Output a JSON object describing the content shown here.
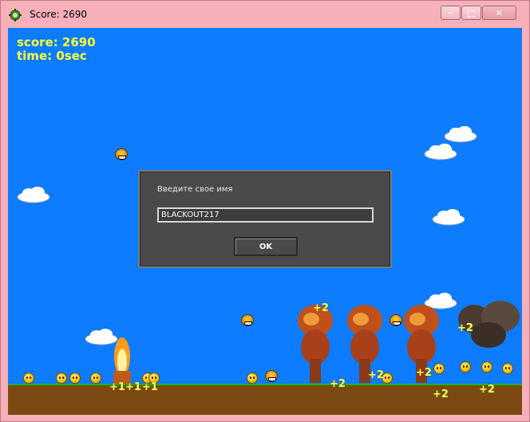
{
  "window": {
    "title": "Score: 2690",
    "controls": {
      "minimize": "─",
      "maximize": "□",
      "close": "✕"
    }
  },
  "hud": {
    "score_line": "score: 2690",
    "time_line": "time: 0sec"
  },
  "dialog": {
    "prompt": "Введите свое имя",
    "name_value": "BLACKOUT217",
    "ok_label": "OK"
  },
  "popups": [
    "+2",
    "+2",
    "+2",
    "+2",
    "+1",
    "+1",
    "+1",
    "+2",
    "+2",
    "+2"
  ],
  "colors": {
    "sky": "#0d7cfe",
    "hud_text": "#ffff33",
    "grass": "#1db41d",
    "dirt": "#7a4a12",
    "dialog_bg": "#4a4a4a"
  }
}
